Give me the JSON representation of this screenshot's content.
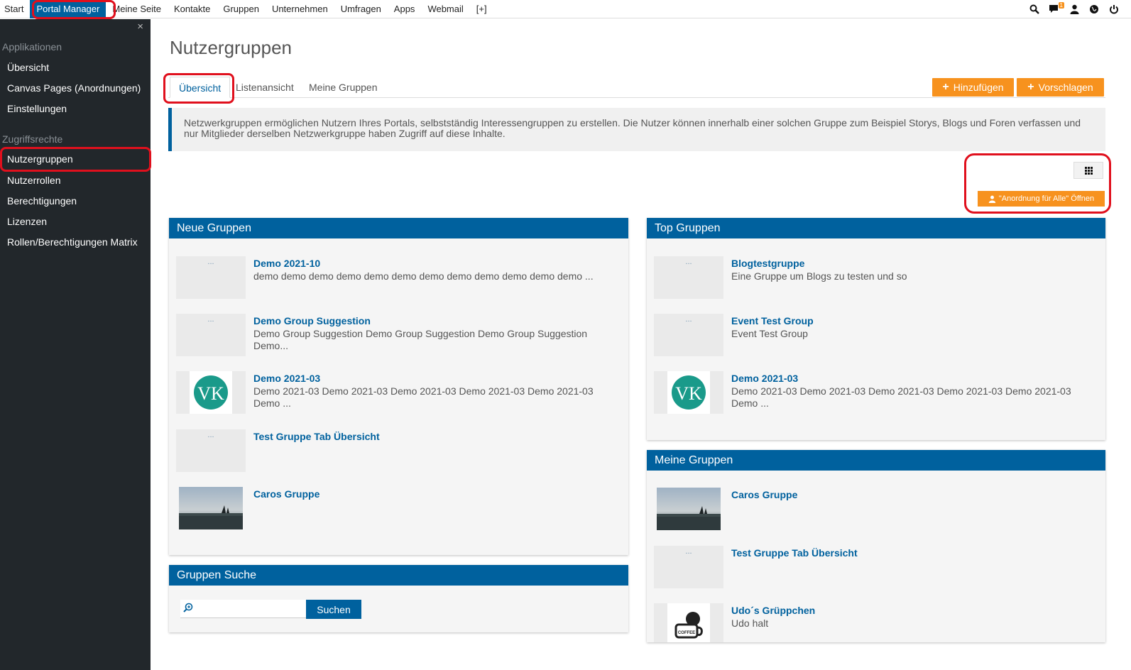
{
  "topnav": {
    "items": [
      "Start",
      "Portal Manager",
      "Meine Seite",
      "Kontakte",
      "Gruppen",
      "Unternehmen",
      "Umfragen",
      "Apps",
      "Webmail",
      "[+]"
    ],
    "active": "Portal Manager",
    "icons": [
      "search-icon",
      "chat-icon",
      "user-icon",
      "globe-icon",
      "power-icon"
    ],
    "notification_count": "1"
  },
  "sidebar": {
    "close_label": "×",
    "section_apps": "Applikationen",
    "apps_items": [
      "Übersicht",
      "Canvas Pages (Anordnungen)",
      "Einstellungen"
    ],
    "section_rights": "Zugriffsrechte",
    "rights_items": [
      "Nutzergruppen",
      "Nutzerrollen",
      "Berechtigungen",
      "Lizenzen",
      "Rollen/Berechtigungen Matrix"
    ],
    "active": "Nutzergruppen"
  },
  "main": {
    "title": "Nutzergruppen",
    "tabs": [
      "Übersicht",
      "Listenansicht",
      "Meine Gruppen"
    ],
    "active_tab": "Übersicht",
    "add_button": "Hinzufügen",
    "suggest_button": "Vorschlagen",
    "info_text": "Netzwerkgruppen ermöglichen Nutzern Ihres Portals, selbstständig Interessengruppen zu erstellen. Die Nutzer können innerhalb einer solchen Gruppe zum Beispiel Storys, Blogs und Foren verfassen und nur Mitglieder derselben Netzwerkgruppe haben Zugriff auf diese Inhalte.",
    "open_layout_button": "\"Anordnung für Alle\" Öffnen"
  },
  "panels": {
    "neue": {
      "title": "Neue Gruppen",
      "entries": [
        {
          "title": "Demo 2021-10",
          "desc": "demo demo demo demo demo demo demo demo demo demo demo demo ...",
          "thumb": "..."
        },
        {
          "title": "Demo Group Suggestion",
          "desc": "Demo Group Suggestion Demo Group Suggestion Demo Group Suggestion Demo...",
          "thumb": "..."
        },
        {
          "title": "Demo 2021-03",
          "desc": "Demo 2021-03 Demo 2021-03 Demo 2021-03 Demo 2021-03 Demo 2021-03 Demo ...",
          "thumb": "vk-logo"
        },
        {
          "title": "Test Gruppe Tab Übersicht",
          "desc": "",
          "thumb": "..."
        },
        {
          "title": "Caros Gruppe",
          "desc": "",
          "thumb": "photo"
        }
      ]
    },
    "top": {
      "title": "Top Gruppen",
      "entries": [
        {
          "title": "Blogtestgruppe",
          "desc": "Eine Gruppe um Blogs zu testen und so",
          "thumb": "..."
        },
        {
          "title": "Event Test Group",
          "desc": "Event Test Group",
          "thumb": "..."
        },
        {
          "title": "Demo 2021-03",
          "desc": "Demo 2021-03 Demo 2021-03 Demo 2021-03 Demo 2021-03 Demo 2021-03 Demo ...",
          "thumb": "vk-logo"
        }
      ]
    },
    "meine": {
      "title": "Meine Gruppen",
      "entries": [
        {
          "title": "Caros Gruppe",
          "desc": "",
          "thumb": "photo"
        },
        {
          "title": "Test Gruppe Tab Übersicht",
          "desc": "",
          "thumb": "..."
        },
        {
          "title": "Udo´s Grüppchen",
          "desc": "Udo halt",
          "thumb": "coffee-logo"
        }
      ]
    },
    "suche": {
      "title": "Gruppen Suche",
      "input_value": "",
      "button": "Suchen"
    }
  },
  "colors": {
    "brand_blue": "#00619e",
    "orange": "#f7921e",
    "sidebar_bg": "#22272b",
    "highlight_red": "#e0101d"
  }
}
